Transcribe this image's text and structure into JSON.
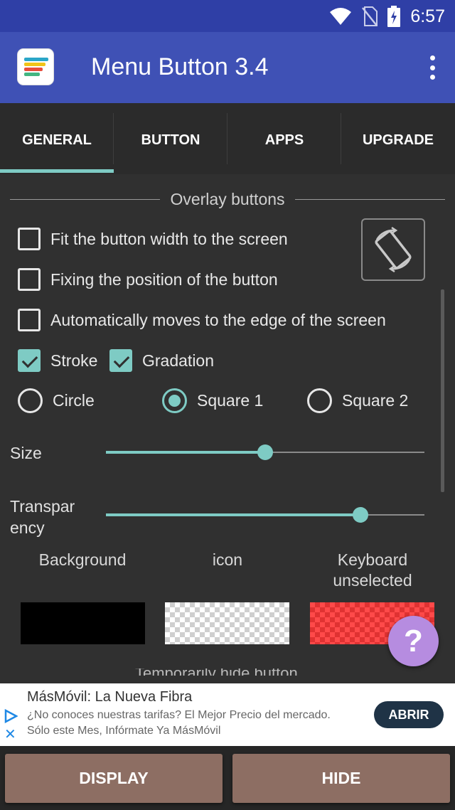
{
  "status_bar": {
    "time": "6:57"
  },
  "app_bar": {
    "title": "Menu Button 3.4"
  },
  "tabs": [
    {
      "label": "GENERAL",
      "selected": true
    },
    {
      "label": "BUTTON",
      "selected": false
    },
    {
      "label": "APPS",
      "selected": false
    },
    {
      "label": "UPGRADE",
      "selected": false
    }
  ],
  "overlay": {
    "section_title": "Overlay buttons",
    "options": [
      {
        "label": "Fit the button width to the screen",
        "checked": false
      },
      {
        "label": "Fixing the position of the button",
        "checked": false
      },
      {
        "label": "Automatically moves to the edge of the screen",
        "checked": false
      },
      {
        "label": "Stroke",
        "checked": true
      },
      {
        "label": "Gradation",
        "checked": true
      }
    ],
    "shape": {
      "options": [
        "Circle",
        "Square 1",
        "Square 2"
      ],
      "selected": "Square 1"
    },
    "size": {
      "label": "Size",
      "value": 0.5
    },
    "transparency": {
      "label": "Transpar\nency",
      "value": 0.8
    },
    "colors": {
      "background_label": "Background",
      "icon_label": "icon",
      "keyboard_label": "Keyboard\nunselected",
      "background_color": "#000000",
      "keyboard_color": "#ff4a4a"
    },
    "hide_label": "Temporarily hide button"
  },
  "help": {
    "label": "?"
  },
  "ad": {
    "title": "MásMóvil: La Nueva Fibra",
    "line1": "¿No conoces nuestras tarifas? El Mejor Precio del mercado.",
    "line2": "Sólo este Mes, Infórmate Ya MásMóvil",
    "cta": "ABRIR"
  },
  "bottom": {
    "display": "DISPLAY",
    "hide": "HIDE"
  },
  "accent": "#7ecbc4",
  "app_bar_color": "#3f51b5",
  "bottom_button_color": "#8d6e63"
}
